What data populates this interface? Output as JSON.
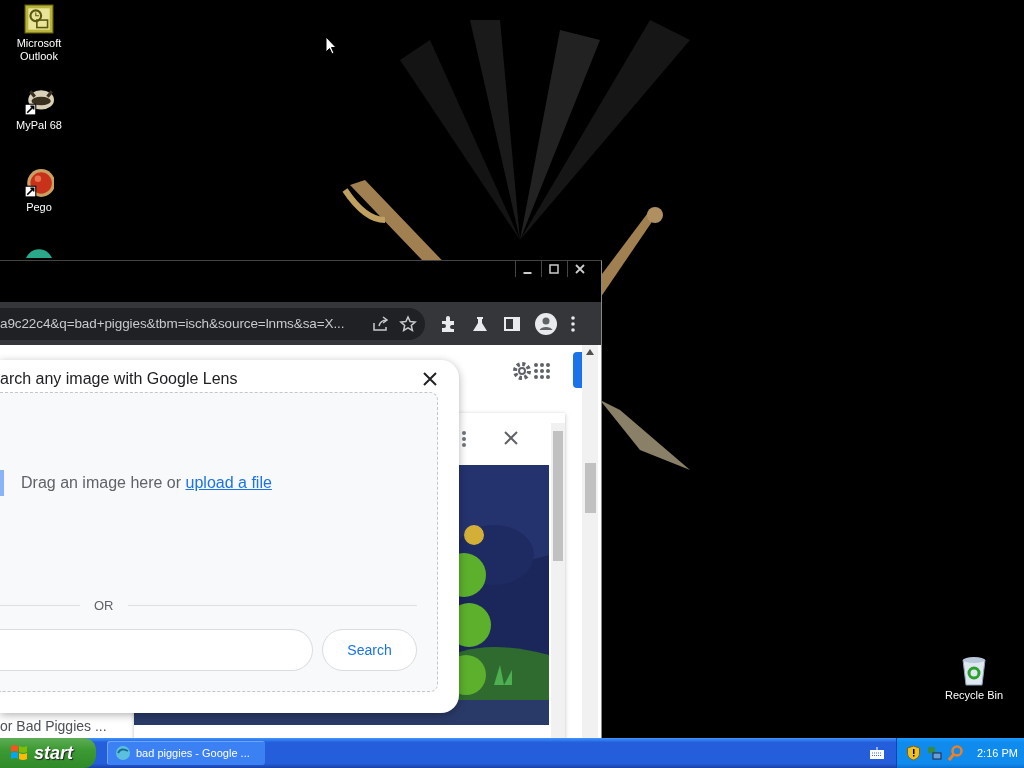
{
  "desktop": {
    "icons": [
      {
        "label": "Microsoft Outlook"
      },
      {
        "label": "MyPal 68"
      },
      {
        "label": "Pego"
      }
    ],
    "recycle_bin": {
      "label": "Recycle Bin"
    }
  },
  "browser": {
    "address": "a9c22c4&q=bad+piggies&tbm=isch&source=lnms&sa=X...",
    "page": {
      "result_caption": "or Bad Piggies ...",
      "lens_dialog": {
        "title": "arch any image with Google Lens",
        "drop_text": "Drag an image here or",
        "upload_link": "upload a file",
        "divider": "OR",
        "search_button": "Search"
      }
    }
  },
  "taskbar": {
    "start": "start",
    "tasks": [
      {
        "label": "bad piggies - Google ...",
        "selected": false
      }
    ],
    "clock": "2:16 PM"
  }
}
